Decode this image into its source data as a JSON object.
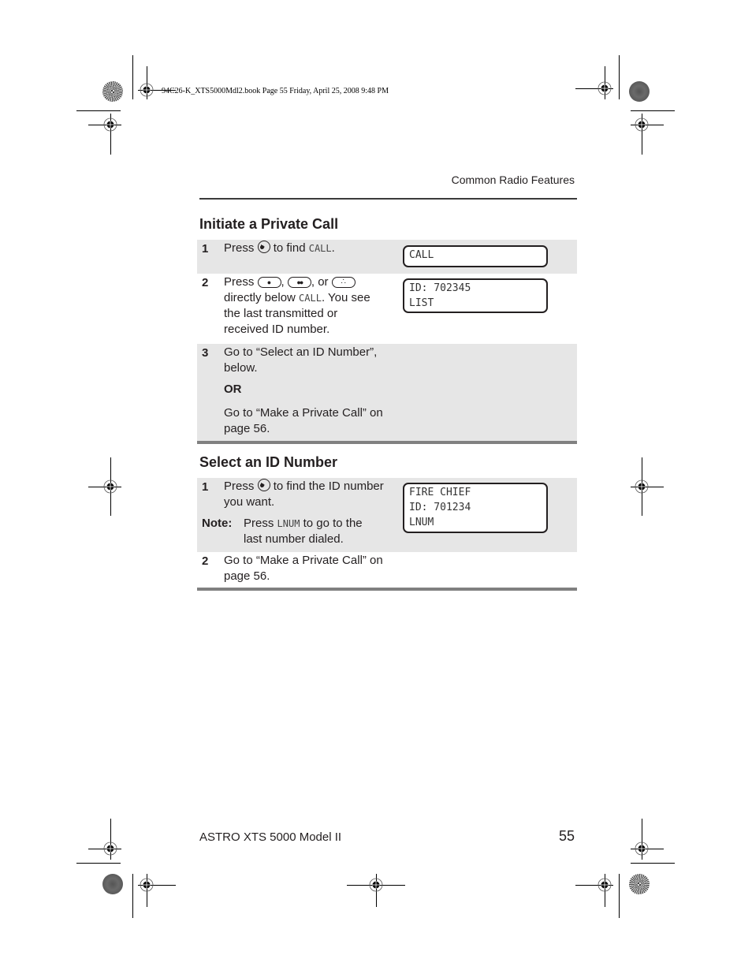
{
  "print_header": {
    "crop_label": "94C26-K_XTS5000Mdl2.book  Page 55  Friday, April 25, 2008  9:48 PM"
  },
  "running_head": "Common Radio Features",
  "sections": [
    {
      "title": "Initiate a Private Call",
      "steps": [
        {
          "num": "1",
          "text_before": "Press",
          "icon": "nav-button-icon",
          "text_after": "to find",
          "mono": "CALL",
          "text_end": ".",
          "lcd": [
            "CALL"
          ]
        },
        {
          "num": "2",
          "text_before": "Press",
          "icons": [
            "softkey-1-icon",
            "softkey-2-icon",
            "softkey-3-icon"
          ],
          "sep1": ",",
          "sep2": ", or",
          "line2_before": "directly below",
          "mono": "CALL",
          "line2_after": ". You see the last transmitted or received ID number.",
          "lcd": [
            "ID: 702345",
            "LIST"
          ]
        },
        {
          "num": "3",
          "text1": "Go to “Select an ID Number”, below.",
          "or": "OR",
          "text2": "Go to “Make a Private Call” on page 56."
        }
      ]
    },
    {
      "title": "Select an ID Number",
      "steps": [
        {
          "num": "1",
          "text_before": "Press",
          "icon": "nav-button-icon",
          "text_after": "to find the ID number you want.",
          "note_label": "Note:",
          "note_before": "Press",
          "note_mono": "LNUM",
          "note_after": "to go to the last number dialed.",
          "lcd": [
            "FIRE CHIEF",
            "ID: 701234",
            "LNUM"
          ]
        },
        {
          "num": "2",
          "text": "Go to “Make a Private Call” on page 56."
        }
      ]
    }
  ],
  "footer": {
    "product": "ASTRO XTS 5000 Model II",
    "page_number": "55"
  }
}
